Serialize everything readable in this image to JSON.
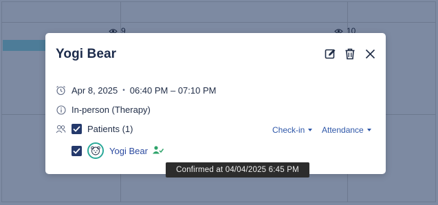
{
  "calendar": {
    "day_9": "9",
    "day_10": "10"
  },
  "event": {
    "title": "Yogi Bear",
    "date": "Apr 8, 2025",
    "separator": "•",
    "time_range": "06:40 PM – 07:10 PM",
    "appointment_type": "In-person (Therapy)",
    "patients_label": "Patients (1)",
    "checkin_label": "Check-in",
    "attendance_label": "Attendance",
    "patient": {
      "name": "Yogi Bear",
      "status_icon": "person-check-icon"
    }
  },
  "tooltip": {
    "text": "Confirmed at 04/04/2025  6:45 PM"
  },
  "icons": {
    "edit": "edit-icon",
    "delete": "trash-icon",
    "close": "close-icon",
    "clock": "alarm-clock-icon",
    "info": "info-icon",
    "group": "users-icon",
    "view": "eye-icon"
  },
  "colors": {
    "primary_navy": "#24396b",
    "link_blue": "#2d56a8",
    "avatar_teal": "#2aa898",
    "confirmed_green": "#2ea36a",
    "overlay": "#7d8aa2"
  }
}
